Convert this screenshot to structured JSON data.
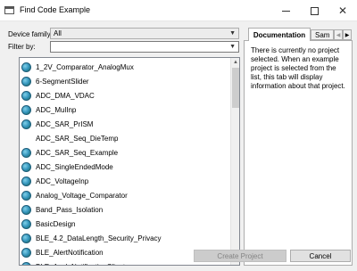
{
  "window": {
    "title": "Find Code Example",
    "minimize_icon": "minimize-icon",
    "maximize_icon": "maximize-icon",
    "close_icon": "close-icon"
  },
  "filters": {
    "family_label": "Device family:",
    "family_value": "All",
    "filter_label": "Filter by:",
    "filter_value": ""
  },
  "examples": [
    {
      "label": "1_2V_Comparator_AnalogMux",
      "icon": "globe-icon"
    },
    {
      "label": "6-SegmentSlider",
      "icon": "globe-icon"
    },
    {
      "label": "ADC_DMA_VDAC",
      "icon": "globe-icon"
    },
    {
      "label": "ADC_MulInp",
      "icon": "globe-icon"
    },
    {
      "label": "ADC_SAR_PrISM",
      "icon": "globe-icon"
    },
    {
      "label": "ADC_SAR_Seq_DieTemp",
      "icon": ""
    },
    {
      "label": "ADC_SAR_Seq_Example",
      "icon": "globe-icon"
    },
    {
      "label": "ADC_SingleEndedMode",
      "icon": "globe-icon"
    },
    {
      "label": "ADC_VoltageInp",
      "icon": "globe-icon"
    },
    {
      "label": "Analog_Voltage_Comparator",
      "icon": "globe-icon"
    },
    {
      "label": "Band_Pass_Isolation",
      "icon": "globe-icon"
    },
    {
      "label": "BasicDesign",
      "icon": "globe-icon"
    },
    {
      "label": "BLE_4.2_DataLength_Security_Privacy",
      "icon": "globe-icon"
    },
    {
      "label": "BLE_AlertNotification",
      "icon": "globe-icon"
    },
    {
      "label": "BLE_AppleNotificationClient",
      "icon": "globe-icon"
    }
  ],
  "panel": {
    "tab_documentation": "Documentation",
    "tab_sample": "Sam",
    "tab_left": "◀",
    "tab_right": "▶",
    "doc_text": "There is currently no project selected. When an example project is selected from the list, this tab will display information about that project."
  },
  "buttons": {
    "create": "Create Project",
    "cancel": "Cancel"
  },
  "colors": {
    "window_bg": "#f0f0f0",
    "disabled_button_bg": "#cccccc",
    "disabled_text": "#838383"
  }
}
